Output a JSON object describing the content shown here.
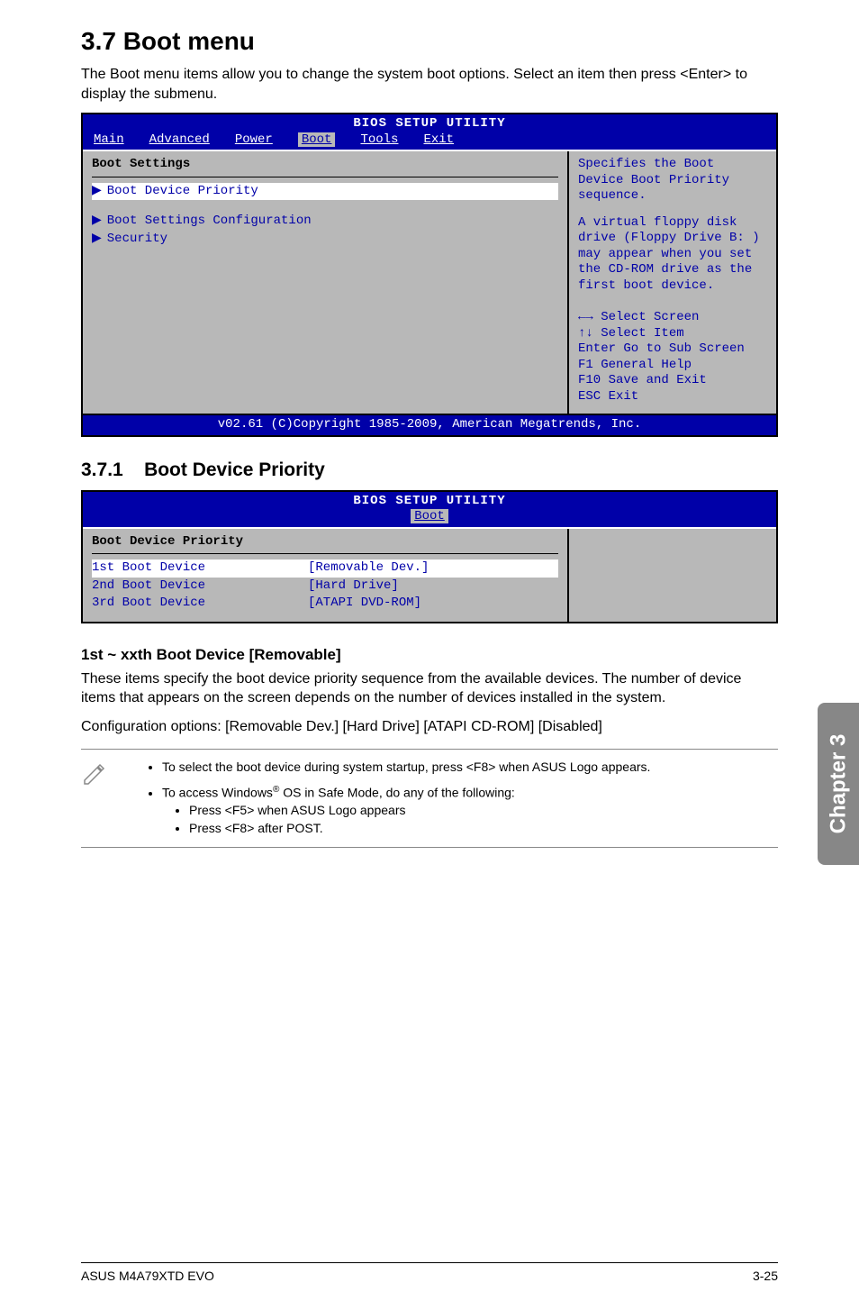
{
  "title": "3.7     Boot menu",
  "intro": "The Boot menu items allow you to change the system boot options. Select an item then press <Enter> to display the submenu.",
  "bios1": {
    "title": "BIOS SETUP UTILITY",
    "tabs": [
      "Main",
      "Advanced",
      "Power",
      "Boot",
      "Tools",
      "Exit"
    ],
    "active_tab": "Boot",
    "left_heading": "Boot Settings",
    "items": [
      "Boot Device Priority",
      "Boot Settings Configuration",
      "Security"
    ],
    "right_desc": "Specifies the Boot Device Boot Priority sequence.",
    "right_note": "A virtual floppy disk drive (Floppy Drive B: ) may appear when you set the CD-ROM drive as the first boot device.",
    "help": {
      "select_screen": "←→   Select Screen",
      "select_item": "↑↓    Select Item",
      "sub_screen": "Enter Go to Sub Screen",
      "f1": "F1    General Help",
      "f10": "F10   Save and Exit",
      "esc": "ESC   Exit"
    },
    "footer": "v02.61 (C)Copyright 1985-2009, American Megatrends, Inc."
  },
  "sub1": {
    "num": "3.7.1",
    "title": "Boot Device Priority"
  },
  "bios2": {
    "title": "BIOS SETUP UTILITY",
    "active_tab": "Boot",
    "left_heading": "Boot Device Priority",
    "rows": [
      {
        "label": "1st Boot Device",
        "value": "[Removable Dev.]"
      },
      {
        "label": "2nd Boot Device",
        "value": "[Hard Drive]"
      },
      {
        "label": "3rd Boot Device",
        "value": "[ATAPI DVD-ROM]"
      }
    ]
  },
  "sub2_title": "1st ~ xxth Boot Device [Removable]",
  "sub2_para": "These items specify the boot device priority sequence from the available devices. The number of device items that appears on the screen depends on the number of devices installed in the system.",
  "sub2_config": "Configuration options: [Removable Dev.] [Hard Drive] [ATAPI CD-ROM] [Disabled]",
  "notes": {
    "n1": "To select the boot device during system startup, press <F8> when ASUS Logo appears.",
    "n2": "To access Windows",
    "n2b": " OS in Safe Mode, do any of the following:",
    "n2_sub1": "Press <F5> when ASUS Logo appears",
    "n2_sub2": "Press <F8> after POST."
  },
  "side_tab": "Chapter 3",
  "footer_left": "ASUS M4A79XTD EVO",
  "footer_right": "3-25"
}
